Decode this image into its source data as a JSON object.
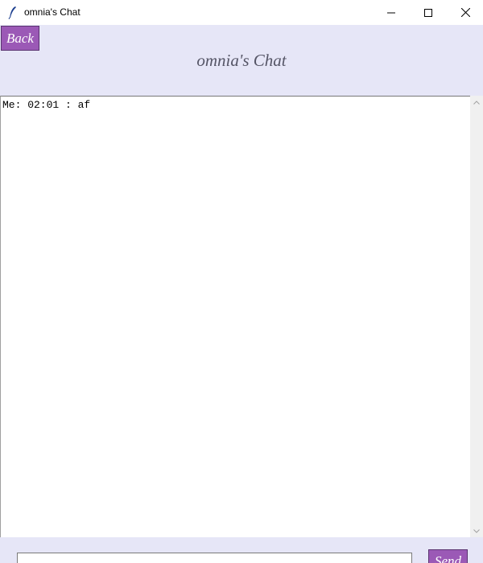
{
  "window": {
    "title": "omnia's Chat",
    "icons": {
      "app": "feather-icon",
      "minimize": "minimize-icon",
      "maximize": "maximize-icon",
      "close": "close-icon"
    }
  },
  "header": {
    "back_label": "Back",
    "chat_title": "omnia's Chat"
  },
  "chat": {
    "messages": [
      {
        "text": "Me: 02:01 : af"
      }
    ]
  },
  "composer": {
    "input_value": "",
    "send_label": "Send"
  },
  "colors": {
    "accent": "#9b59b6",
    "header_bg": "#e6e6f7",
    "title_text": "#555566"
  }
}
